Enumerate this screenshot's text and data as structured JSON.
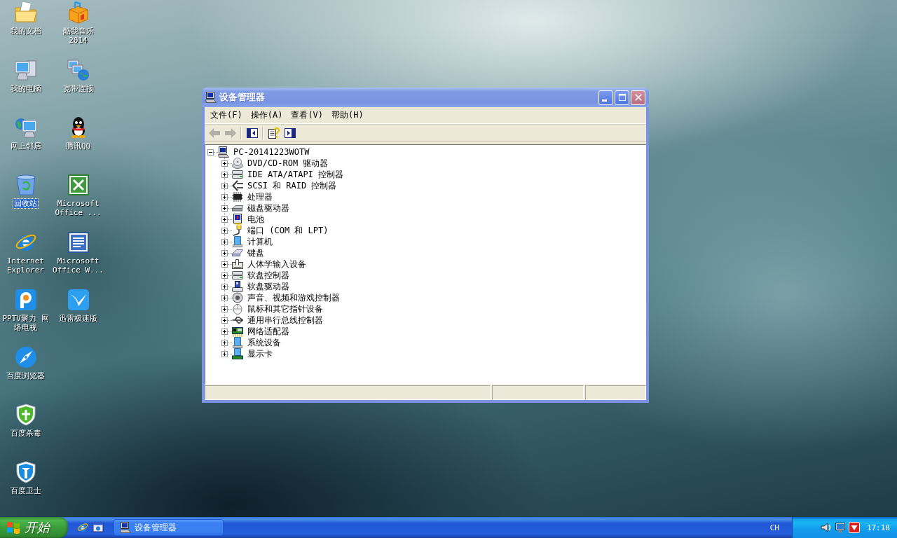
{
  "desktop": {
    "icons": [
      {
        "kind": "documents",
        "label": "我的文档",
        "selected": false
      },
      {
        "kind": "computer",
        "label": "我的电脑",
        "selected": false
      },
      {
        "kind": "neighborhood",
        "label": "网上邻居",
        "selected": false
      },
      {
        "kind": "recycle",
        "label": "回收站",
        "selected": true
      },
      {
        "kind": "browser",
        "label": "Internet Explorer",
        "selected": false
      },
      {
        "kind": "pptv",
        "label": "PPTV聚力 网络电视",
        "selected": false
      },
      {
        "kind": "compass",
        "label": "百度浏览器",
        "selected": false
      },
      {
        "kind": "shield-cross",
        "label": "百度杀毒",
        "selected": false
      },
      {
        "kind": "shield-t",
        "label": "百度卫士",
        "selected": false
      },
      {
        "kind": "music",
        "label": "酷我音乐 2014",
        "selected": false
      },
      {
        "kind": "broadband",
        "label": "宽带连接",
        "selected": false
      },
      {
        "kind": "qq",
        "label": "腾讯QQ",
        "selected": false
      },
      {
        "kind": "excel",
        "label": "Microsoft Office ...",
        "selected": false
      },
      {
        "kind": "word",
        "label": "Microsoft Office W...",
        "selected": false
      },
      {
        "kind": "xunlei",
        "label": "迅雷极速版",
        "selected": false
      }
    ]
  },
  "window": {
    "title": "设备管理器",
    "active": false,
    "menu": [
      "文件(F)",
      "操作(A)",
      "查看(V)",
      "帮助(H)"
    ],
    "toolbar": [
      [
        {
          "kind": "back",
          "disabled": true
        },
        {
          "kind": "forward",
          "disabled": true
        }
      ],
      [
        {
          "kind": "console-tree",
          "disabled": false
        }
      ],
      [
        {
          "kind": "properties",
          "disabled": false
        },
        {
          "kind": "pane",
          "disabled": false
        }
      ]
    ],
    "tree": [
      {
        "kind": "computer",
        "label": "PC-20141223WOTW",
        "expanded": true,
        "children": [
          {
            "kind": "dvd",
            "label": "DVD/CD-ROM 驱动器",
            "expanded": false
          },
          {
            "kind": "ide",
            "label": "IDE ATA/ATAPI 控制器",
            "expanded": false
          },
          {
            "kind": "scsi",
            "label": "SCSI 和 RAID 控制器",
            "expanded": false
          },
          {
            "kind": "cpu",
            "label": "处理器",
            "expanded": false
          },
          {
            "kind": "disk",
            "label": "磁盘驱动器",
            "expanded": false
          },
          {
            "kind": "battery",
            "label": "电池",
            "expanded": false
          },
          {
            "kind": "port",
            "label": "端口 (COM 和 LPT)",
            "expanded": false
          },
          {
            "kind": "pc",
            "label": "计算机",
            "expanded": false
          },
          {
            "kind": "keyboard",
            "label": "键盘",
            "expanded": false
          },
          {
            "kind": "hid",
            "label": "人体学输入设备",
            "expanded": false
          },
          {
            "kind": "floppy-controller",
            "label": "软盘控制器",
            "expanded": false
          },
          {
            "kind": "floppy",
            "label": "软盘驱动器",
            "expanded": false
          },
          {
            "kind": "sound",
            "label": "声音、视频和游戏控制器",
            "expanded": false
          },
          {
            "kind": "mouse",
            "label": "鼠标和其它指针设备",
            "expanded": false
          },
          {
            "kind": "usb",
            "label": "通用串行总线控制器",
            "expanded": false
          },
          {
            "kind": "network",
            "label": "网络适配器",
            "expanded": false
          },
          {
            "kind": "system",
            "label": "系统设备",
            "expanded": false
          },
          {
            "kind": "display",
            "label": "显示卡",
            "expanded": false
          }
        ]
      }
    ]
  },
  "taskbar": {
    "start": "开始",
    "quick_launch": [
      {
        "kind": "browser"
      },
      {
        "kind": "screen"
      }
    ],
    "tasks": [
      {
        "label": "设备管理器",
        "selected": false
      }
    ],
    "language": "CH",
    "tray": [
      {
        "kind": "speaker"
      },
      {
        "kind": "monitor"
      },
      {
        "kind": "alert"
      }
    ],
    "clock": "17:18"
  }
}
